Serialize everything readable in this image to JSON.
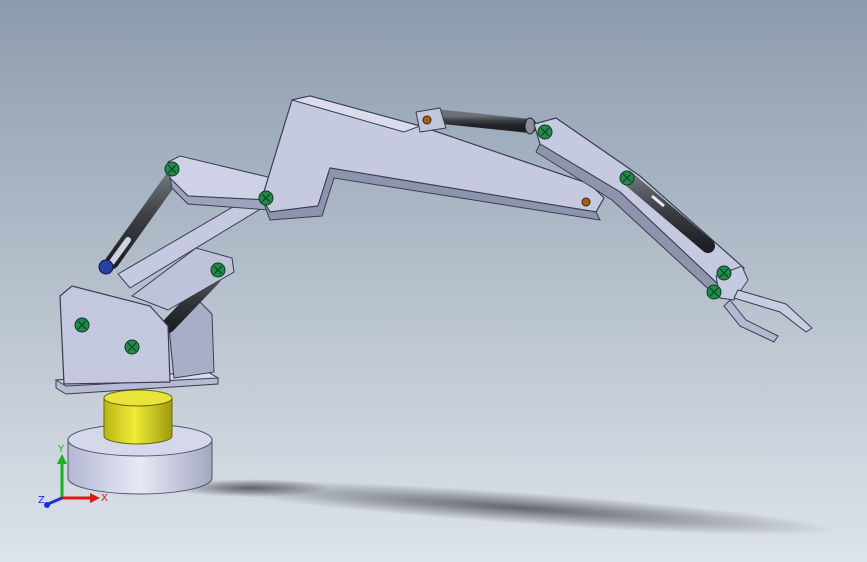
{
  "colors": {
    "background_top": "#8d9cad",
    "background_bottom": "#dde3ea",
    "arm_metal": "#c4c8dc",
    "arm_metal_dark": "#8f94ad",
    "cylinder": "#3c3f44",
    "base_yellow": "#e0dc1e",
    "pin_green": "#1f8a4a",
    "pin_blue": "#2741a6",
    "pin_orange": "#a25f1e",
    "shadow": "#3c4046"
  },
  "triad": {
    "x_label": "X",
    "y_label": "Y",
    "z_label": "Z",
    "x_color": "#e01818",
    "y_color": "#18b418",
    "z_color": "#1830e0"
  }
}
